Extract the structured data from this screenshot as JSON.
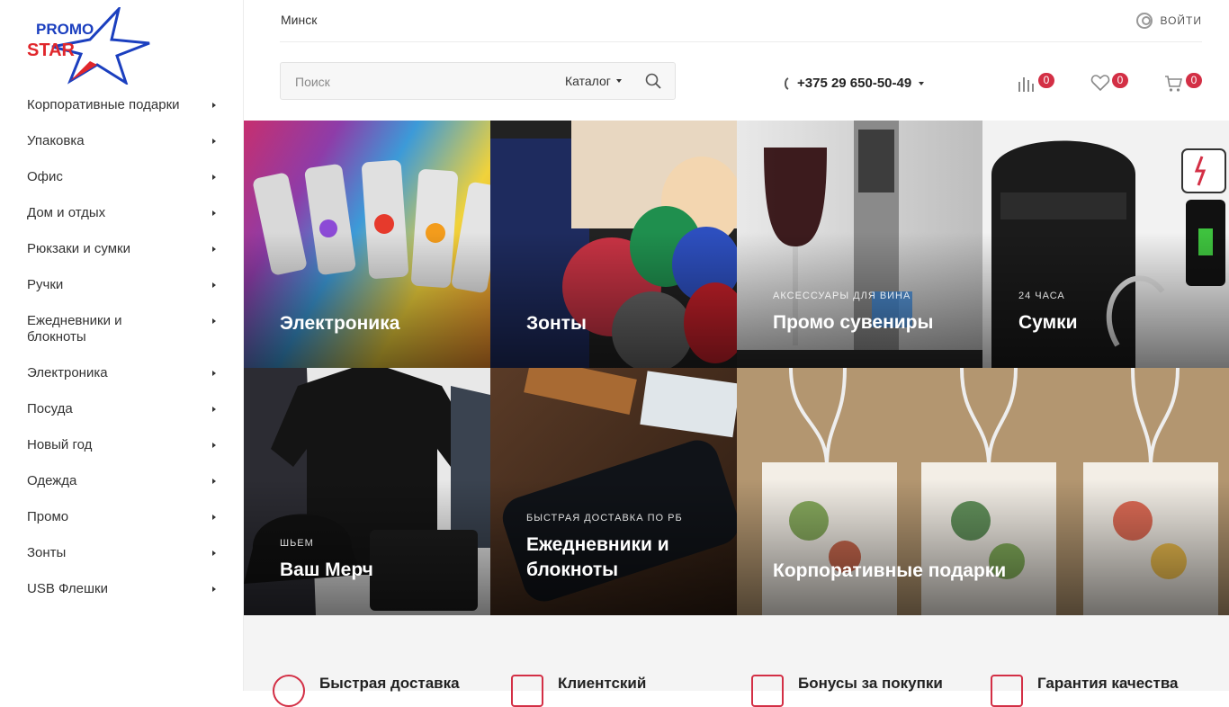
{
  "logo": {
    "line1": "PROMO",
    "line2": "STAR"
  },
  "sidebar": {
    "items": [
      {
        "label": "Корпоративные подарки"
      },
      {
        "label": "Упаковка"
      },
      {
        "label": "Офис"
      },
      {
        "label": "Дом и отдых"
      },
      {
        "label": "Рюкзаки и сумки"
      },
      {
        "label": "Ручки"
      },
      {
        "label": "Ежедневники и блокноты"
      },
      {
        "label": "Электроника"
      },
      {
        "label": "Посуда"
      },
      {
        "label": "Новый год"
      },
      {
        "label": "Одежда"
      },
      {
        "label": "Промо"
      },
      {
        "label": "Зонты"
      },
      {
        "label": "USB Флешки"
      }
    ]
  },
  "header": {
    "city": "Минск",
    "login_label": "ВОЙТИ",
    "search_placeholder": "Поиск",
    "catalog_label": "Каталог",
    "phone": "+375 29 650-50-49",
    "counters": {
      "compare": "0",
      "favorites": "0",
      "cart": "0"
    }
  },
  "tiles": [
    {
      "subtitle": "",
      "title": "Электроника"
    },
    {
      "subtitle": "",
      "title": "Зонты"
    },
    {
      "subtitle": "АКСЕССУАРЫ ДЛЯ ВИНА",
      "title": "Промо сувениры"
    },
    {
      "subtitle": "24 ЧАСА",
      "title": "Сумки"
    },
    {
      "subtitle": "ШЬЕМ",
      "title": "Ваш Мерч"
    },
    {
      "subtitle": "БЫСТРАЯ ДОСТАВКА ПО РБ",
      "title": "Ежедневники и блокноты"
    },
    {
      "subtitle": "",
      "title": "Корпоративные подарки"
    }
  ],
  "features": [
    {
      "title": "Быстрая доставка"
    },
    {
      "title": "Клиентский"
    },
    {
      "title": "Бонусы за покупки"
    },
    {
      "title": "Гарантия качества"
    }
  ],
  "colors": {
    "accent": "#d32f45",
    "logo_blue": "#1b3fbf",
    "logo_red": "#e0272c"
  }
}
